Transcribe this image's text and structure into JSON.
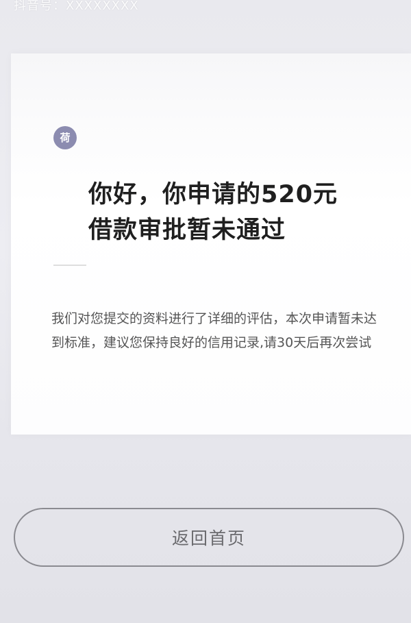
{
  "status_bar": {
    "watermark_text": "抖音号：XXXXXXXX"
  },
  "card": {
    "logo_icon": "company-logo-icon",
    "logo_glyph": "荷",
    "title_line1": "你好，你申请的520元",
    "title_line2": "借款审批暂未通过",
    "description": "我们对您提交的资料进行了详细的评估，本次申请暂未达到标准，建议您保持良好的信用记录,请30天后再次尝试"
  },
  "footer": {
    "return_button_label": "返回首页"
  },
  "colors": {
    "logo_bg": "#8c8cb0",
    "button_border": "#8a8a90",
    "title_text": "#1f1f1f",
    "desc_text": "#555555"
  }
}
